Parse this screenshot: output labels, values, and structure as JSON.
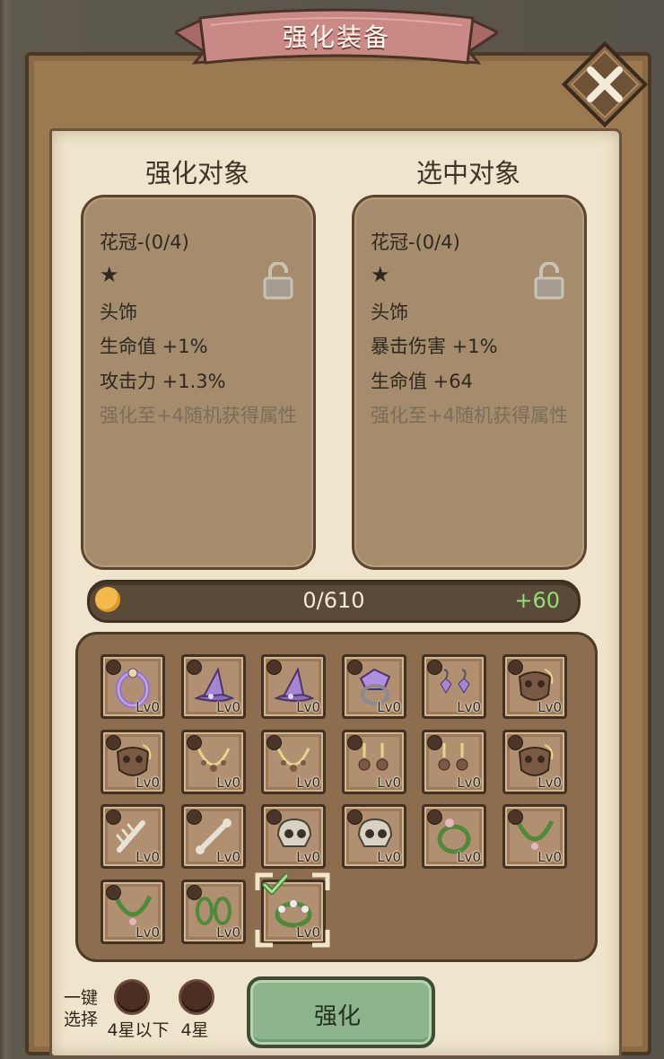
{
  "title": "强化装备",
  "left_panel": {
    "heading": "强化对象",
    "name": "花冠-(0/4)",
    "star": "★",
    "slot_type": "头饰",
    "stats": [
      "生命值 +1%",
      "攻击力 +1.3%"
    ],
    "hint": "强化至+4随机获得属性"
  },
  "right_panel": {
    "heading": "选中对象",
    "name": "花冠-(0/4)",
    "star": "★",
    "slot_type": "头饰",
    "stats": [
      "暴击伤害 +1%",
      "生命值 +64"
    ],
    "hint": "强化至+4随机获得属性"
  },
  "progress": {
    "text": "0/610",
    "gain": "+60",
    "fraction": 0
  },
  "inventory": {
    "level_label": "Lv0",
    "items": [
      {
        "icon": "purple-ring-icon"
      },
      {
        "icon": "purple-hat-icon"
      },
      {
        "icon": "purple-hat-icon"
      },
      {
        "icon": "purple-gem-ring-icon"
      },
      {
        "icon": "purple-earrings-icon"
      },
      {
        "icon": "brown-mask-icon"
      },
      {
        "icon": "brown-mask-icon"
      },
      {
        "icon": "gold-necklace-icon"
      },
      {
        "icon": "gold-necklace-icon"
      },
      {
        "icon": "gold-earrings-icon"
      },
      {
        "icon": "gold-earrings-icon"
      },
      {
        "icon": "brown-mask-icon"
      },
      {
        "icon": "bone-claw-icon"
      },
      {
        "icon": "bone-icon"
      },
      {
        "icon": "skull-icon"
      },
      {
        "icon": "skull-icon"
      },
      {
        "icon": "green-vine-ring-icon"
      },
      {
        "icon": "green-vine-necklace-icon"
      },
      {
        "icon": "green-vine-necklace-icon"
      },
      {
        "icon": "green-vine-earrings-icon"
      },
      {
        "icon": "flower-crown-icon",
        "selected": true
      }
    ]
  },
  "bottom": {
    "one_key_select": "一键\n选择",
    "filter_1": "4星以下",
    "filter_2": "4星",
    "enhance_button": "强化"
  },
  "colors": {
    "progress_gain": "#8fe07a",
    "button_green": "#8db48a",
    "ribbon_pink": "#c98a86"
  }
}
